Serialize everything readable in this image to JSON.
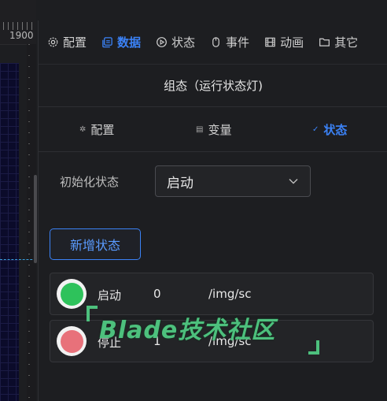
{
  "ruler": {
    "label": "1900"
  },
  "tabs": [
    {
      "label": "配置",
      "icon": "gear-icon",
      "active": false
    },
    {
      "label": "数据",
      "icon": "data-stack-icon",
      "active": true
    },
    {
      "label": "状态",
      "icon": "play-circle-icon",
      "active": false
    },
    {
      "label": "事件",
      "icon": "mouse-icon",
      "active": false
    },
    {
      "label": "动画",
      "icon": "film-icon",
      "active": false
    },
    {
      "label": "其它",
      "icon": "folder-icon",
      "active": false
    }
  ],
  "panel": {
    "title": "组态（运行状态灯)"
  },
  "subtabs": [
    {
      "label": "配置",
      "icon": "gear-small-icon",
      "active": false
    },
    {
      "label": "变量",
      "icon": "file-icon",
      "active": false
    },
    {
      "label": "状态",
      "icon": "check-icon",
      "active": true
    }
  ],
  "init_state": {
    "label": "初始化状态",
    "value": "启动"
  },
  "add_button": {
    "label": "新增状态"
  },
  "states": [
    {
      "name": "启动",
      "value": "0",
      "path": "/img/scada",
      "lamp_color": "#2ec25b"
    },
    {
      "name": "停止",
      "value": "1",
      "path": "/img/scada",
      "lamp_color": "#e8717a"
    }
  ],
  "watermark": {
    "text": "Blade技术社区"
  },
  "colors": {
    "accent": "#3b82f6",
    "background": "#1d1e21",
    "watermark": "#4dc07d"
  }
}
